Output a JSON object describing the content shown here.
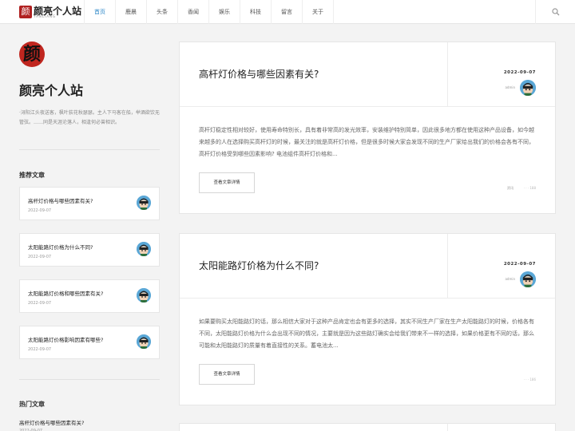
{
  "site": {
    "logo_mark": "颜",
    "logo_text": "颜亮个人站",
    "logo_sub": "YANLIANG"
  },
  "nav": {
    "items": [
      {
        "label": "首页",
        "active": true
      },
      {
        "label": "鹿晨"
      },
      {
        "label": "头条"
      },
      {
        "label": "香闻"
      },
      {
        "label": "娱乐"
      },
      {
        "label": "科技"
      },
      {
        "label": "留言"
      },
      {
        "label": "关于"
      }
    ],
    "search_icon": "search-icon"
  },
  "sidebar": {
    "avatar_char": "颜",
    "title": "颜亮个人站",
    "description": "·浔阳江头夜送客，枫叶荻花秋瑟瑟。主人下马客在船，举酒欲饮无管弦。……同是天涯沦落人，相逢何必曾相识。",
    "recommended_heading": "推荐文章",
    "recommended": [
      {
        "title": "高杆灯价格与哪些因素有关?",
        "date": "2022-09-07"
      },
      {
        "title": "太阳能路灯价格为什么不同?",
        "date": "2022-09-07"
      },
      {
        "title": "太阳能路灯价格和哪些因素有关?",
        "date": "2022-09-07"
      },
      {
        "title": "太阳能路灯价格影响因素有哪些?",
        "date": "2022-09-07"
      }
    ],
    "hot_heading": "热门文章",
    "hot": [
      {
        "title": "高杆灯价格与哪些因素有关?",
        "date": "2022-09-07"
      }
    ]
  },
  "articles": [
    {
      "title": "高杆灯价格与哪些因素有关?",
      "date": "2022-09-07",
      "author": "admin",
      "body": "高杆灯稳定性相对较好，使用寿命特别长，具有着非常高的发光效率，安装维护特别简单，因此很多地方都在使用这种产品设备，如今越来越多的人在选择购买高杆灯的时候，最关注的就是高杆灯价格，但是很多时候大家会发现不同的生产厂家给出我们的价格会各有不同，高杆灯价格受到哪些因素影响? 电池组件高杆灯价格和...",
      "button": "查看文章详情",
      "category": "资讯",
      "views": "· · · 188"
    },
    {
      "title": "太阳能路灯价格为什么不同?",
      "date": "2022-09-07",
      "author": "admin",
      "body": "如果要购买太阳能路灯的话，那么相信大家对于这种产品肯定也会有更多的选择，其实不同生产厂家在生产太阳能路灯的时候，价格各有不同，太阳能路灯价格为什么会出现不同的情况，主要就是因为这些路灯确实会给我们带来不一样的选择，如果价格更有不同的话，那么可能和太阳能路灯的质量有着直接性的关系。蓄电池太...",
      "button": "查看文章详情",
      "category": "",
      "views": "· · · 186"
    }
  ],
  "colors": {
    "accent": "#2a86c7",
    "logo_red": "#b02020",
    "background": "#f3f3f3"
  }
}
